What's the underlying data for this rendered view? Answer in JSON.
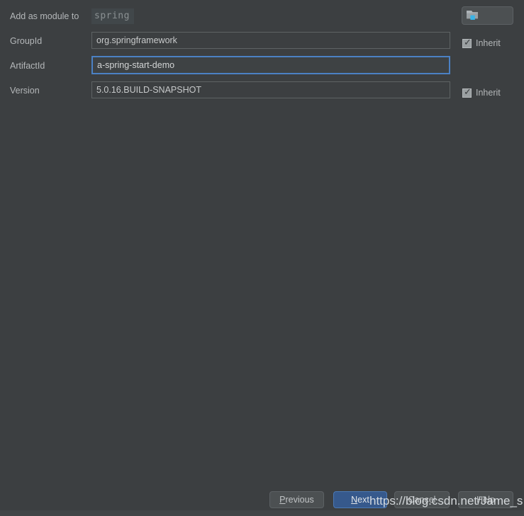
{
  "dialog": {
    "background_color": "#3c3f41",
    "module_row": {
      "label": "Add as module to",
      "value": "spring",
      "browse_icon": "folder-icon"
    },
    "fields": [
      {
        "label": "GroupId",
        "value": "org.springframework",
        "focused": false,
        "inherit": {
          "label": "Inherit",
          "checked": true
        }
      },
      {
        "label": "ArtifactId",
        "value": "a-spring-start-demo",
        "focused": true,
        "inherit": null
      },
      {
        "label": "Version",
        "value": "5.0.16.BUILD-SNAPSHOT",
        "focused": false,
        "inherit": {
          "label": "Inherit",
          "checked": true
        }
      }
    ],
    "buttons": {
      "previous": {
        "mnemonic": "P",
        "rest": "revious"
      },
      "next": {
        "mnemonic": "N",
        "rest": "ext"
      },
      "cancel": {
        "label": "Cancel"
      },
      "help": {
        "label": "Help"
      }
    },
    "accent_color": "#36598c",
    "focus_border_color": "#4b81c4"
  },
  "watermark": {
    "text": "https://blog.csdn.net/Jame_s"
  }
}
